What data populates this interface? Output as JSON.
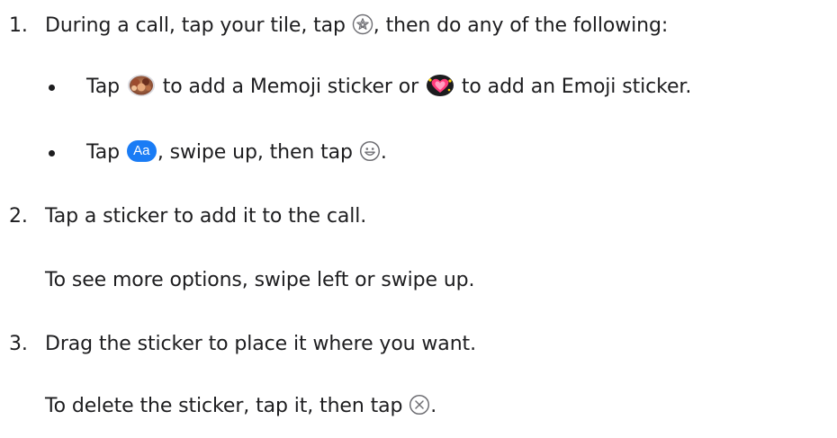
{
  "steps": [
    {
      "number": "1.",
      "text_before": "During a call, tap your tile, tap",
      "icon_name": "sticker-effects-icon",
      "text_after": ", then do any of the following:",
      "bullets": [
        {
          "part1": "Tap",
          "icon1": "memoji-stickers-icon",
          "part2": "to add a Memoji sticker or",
          "icon2": "emoji-stickers-icon",
          "part3": "to add an Emoji sticker."
        },
        {
          "part1": "Tap",
          "icon1": "text-aa-icon",
          "icon1_text": "Aa",
          "part2": ", swipe up, then tap",
          "icon2": "smiley-icon",
          "part3": "."
        }
      ]
    },
    {
      "number": "2.",
      "text": "Tap a sticker to add it to the call.",
      "note": "To see more options, swipe left or swipe up."
    },
    {
      "number": "3.",
      "text": "Drag the sticker to place it where you want.",
      "note_before": "To delete the sticker, tap it, then tap",
      "icon_name": "delete-circle-x-icon",
      "note_after": "."
    }
  ],
  "colors": {
    "text": "#1d1d1f",
    "accent": "#1a7cf5",
    "icon_gray": "#6e6e73"
  }
}
